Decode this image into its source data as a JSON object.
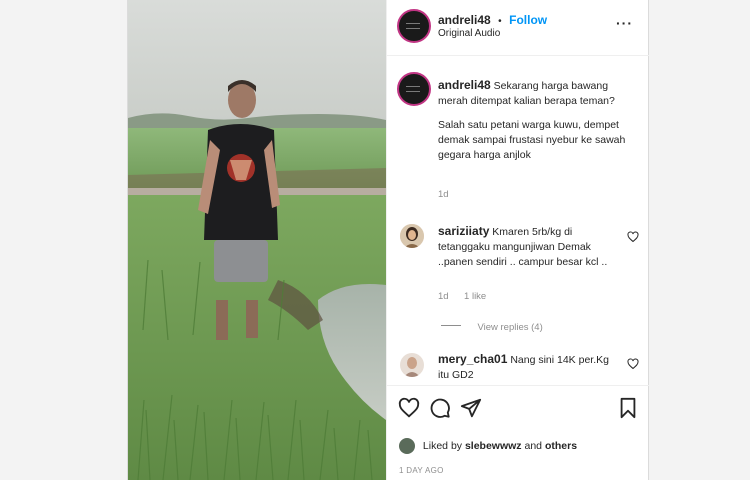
{
  "post": {
    "username": "andreli48",
    "follow_label": "Follow",
    "separator": "•",
    "audio": "Original Audio"
  },
  "caption": {
    "username": "andreli48",
    "line1": "Sekarang harga bawang",
    "line2": "merah ditempat kalian berapa teman?",
    "line3": "Salah satu petani warga kuwu, dempet",
    "line4": "demak sampai frustasi nyebur ke sawah",
    "line5": "gegara harga anjlok",
    "time": "1d"
  },
  "comments": [
    {
      "username": "sariziiaty",
      "line1": "Kmaren 5rb/kg di",
      "line2": "tetanggaku mangunjiwan Demak",
      "line3": "..panen sendiri .. campur besar kcl ..",
      "time": "1d",
      "likes": "1 like",
      "view_replies": "View replies (4)"
    },
    {
      "username": "mery_cha01",
      "line1": "Nang sini 14K per.Kg",
      "line2": "itu GD2"
    }
  ],
  "likes": {
    "prefix": "Liked by",
    "user": "slebewwwz",
    "conj": "and",
    "others": "others"
  },
  "timestamp": "1 DAY AGO",
  "colors": {
    "link_blue": "#0095f6",
    "text": "#262626",
    "muted": "#8e8e8e",
    "border": "#efefef"
  },
  "icons": [
    "more-icon",
    "heart-icon",
    "comment-icon",
    "share-icon",
    "bookmark-icon"
  ]
}
